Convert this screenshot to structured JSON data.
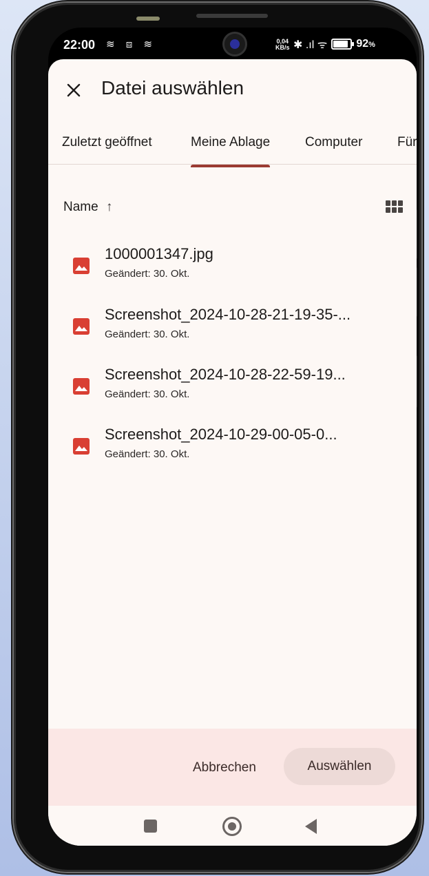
{
  "status_bar": {
    "time": "22:00",
    "left_icons": "≋ ⧈ ≋",
    "speed_value": "0,04",
    "speed_unit": "KB/s",
    "right_icons": "✱ .ıl ᯤ",
    "battery_pct": "92",
    "battery_suffix": "%"
  },
  "header": {
    "close_icon": "close-icon",
    "title": "Datei auswählen"
  },
  "tabs": [
    {
      "label": "Zuletzt geöffnet",
      "active": false
    },
    {
      "label": "Meine Ablage",
      "active": true
    },
    {
      "label": "Computer",
      "active": false
    },
    {
      "label": "Für",
      "active": false
    }
  ],
  "sort": {
    "label": "Name",
    "direction_icon": "↑",
    "view_toggle_icon": "grid-view-icon"
  },
  "files": [
    {
      "name": "1000001347.jpg",
      "meta": "Geändert: 30. Okt.",
      "icon": "image-icon"
    },
    {
      "name": "Screenshot_2024-10-28-21-19-35-...",
      "meta": "Geändert: 30. Okt.",
      "icon": "image-icon"
    },
    {
      "name": "Screenshot_2024-10-28-22-59-19...",
      "meta": "Geändert: 30. Okt.",
      "icon": "image-icon"
    },
    {
      "name": "Screenshot_2024-10-29-00-05-0...",
      "meta": "Geändert: 30. Okt.",
      "icon": "image-icon"
    }
  ],
  "footer": {
    "cancel_label": "Abbrechen",
    "select_label": "Auswählen"
  },
  "colors": {
    "accent": "#9b3b32",
    "file_icon": "#d93f33",
    "sheet_background": "#fdf8f5",
    "footer_background": "#fbe7e5"
  }
}
